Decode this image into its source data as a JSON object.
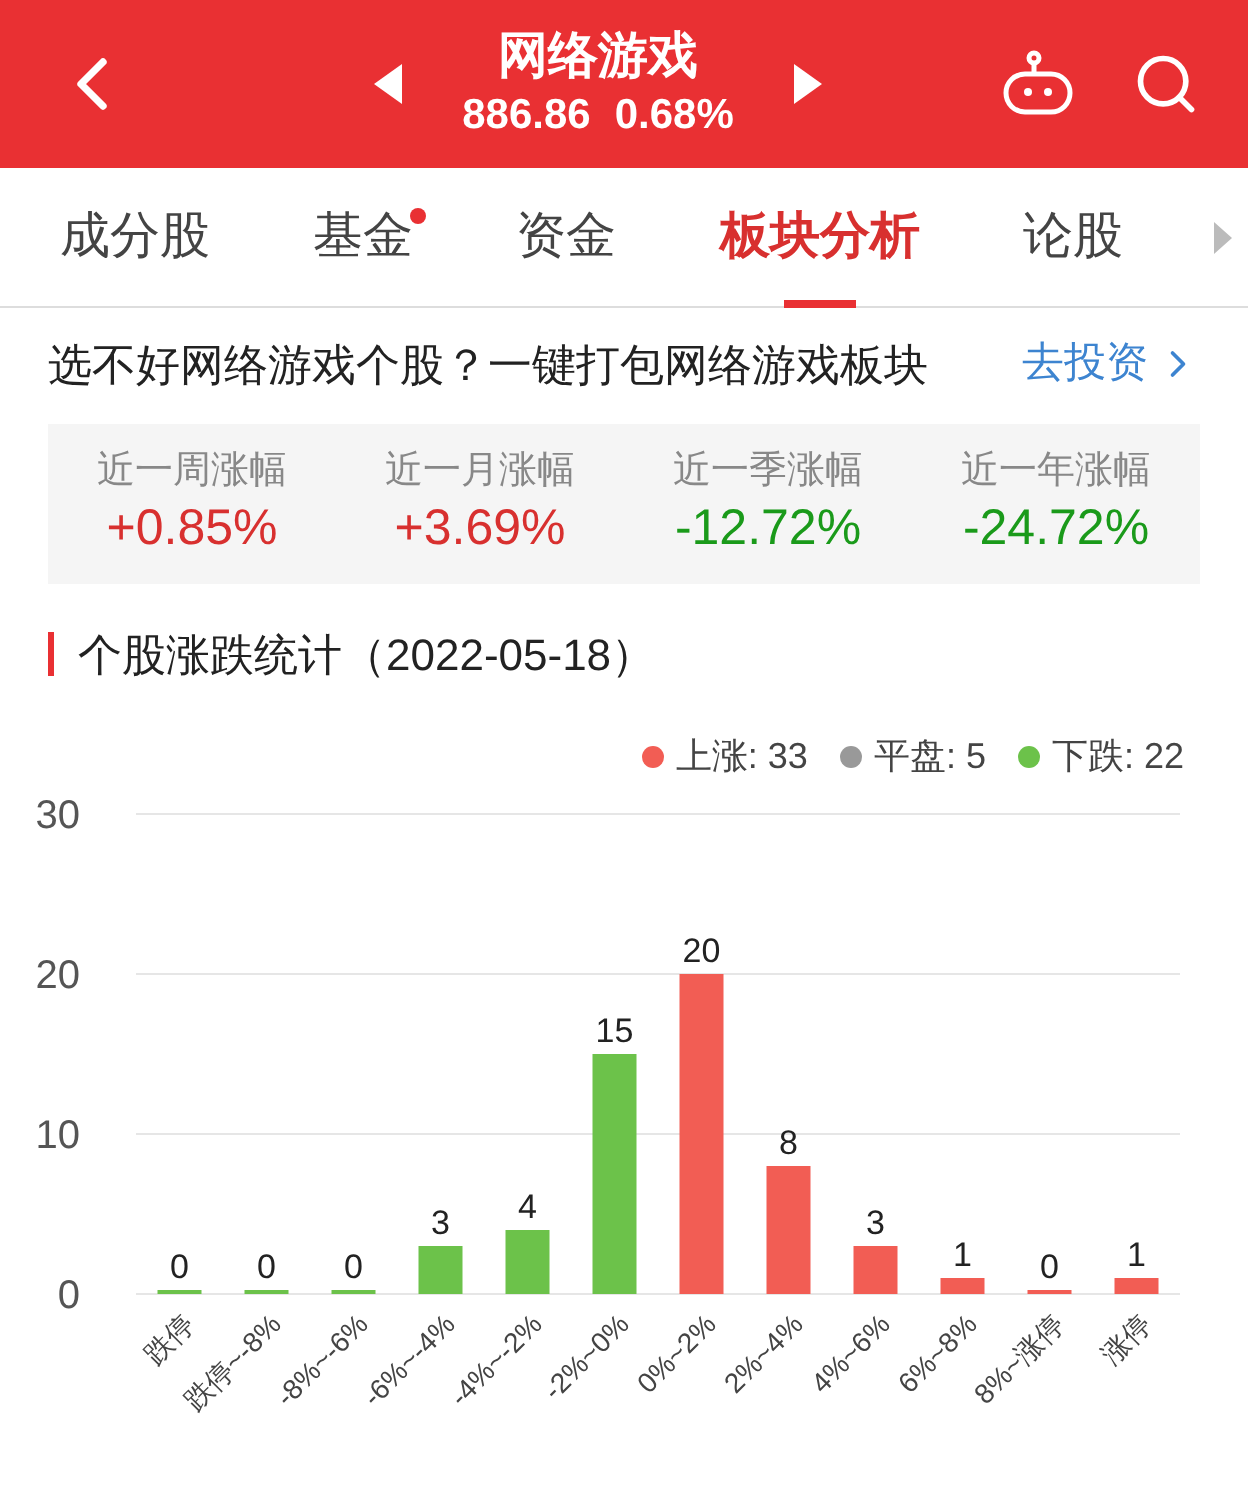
{
  "header": {
    "title": "网络游戏",
    "price": "886.86",
    "change": "0.68%"
  },
  "tabs": [
    {
      "label": "成分股",
      "selected": false,
      "dot": false
    },
    {
      "label": "基金",
      "selected": false,
      "dot": true
    },
    {
      "label": "资金",
      "selected": false,
      "dot": false
    },
    {
      "label": "板块分析",
      "selected": true,
      "dot": false
    },
    {
      "label": "论股",
      "selected": false,
      "dot": false
    }
  ],
  "banner": {
    "text": "选不好网络游戏个股？一键打包网络游戏板块",
    "link": "去投资"
  },
  "stats": [
    {
      "label": "近一周涨幅",
      "value": "+0.85%",
      "color": "#d8302f"
    },
    {
      "label": "近一月涨幅",
      "value": "+3.69%",
      "color": "#d8302f"
    },
    {
      "label": "近一季涨幅",
      "value": "-12.72%",
      "color": "#1a9a1a"
    },
    {
      "label": "近一年涨幅",
      "value": "-24.72%",
      "color": "#1a9a1a"
    }
  ],
  "section_title": "个股涨跌统计（2022-05-18）",
  "legend": [
    {
      "label": "上涨: 33",
      "color": "#f25d54"
    },
    {
      "label": "平盘: 5",
      "color": "#999999"
    },
    {
      "label": "下跌: 22",
      "color": "#6cc24a"
    }
  ],
  "chart_data": {
    "type": "bar",
    "data_labels": true,
    "yticks": [
      0,
      10,
      20,
      30
    ],
    "ylim": [
      0,
      30
    ],
    "categories": [
      "跌停",
      "跌停~-8%",
      "-8%~-6%",
      "-6%~-4%",
      "-4%~-2%",
      "-2%~0%",
      "0%~2%",
      "2%~4%",
      "4%~6%",
      "6%~8%",
      "8%~涨停",
      "涨停"
    ],
    "series": [
      {
        "color": "#6cc24a",
        "values": [
          0,
          0,
          0,
          3,
          4,
          15,
          null,
          null,
          null,
          null,
          null,
          null
        ]
      },
      {
        "color": "#f25d54",
        "values": [
          null,
          null,
          null,
          null,
          null,
          null,
          20,
          8,
          3,
          1,
          0,
          1
        ]
      }
    ]
  }
}
